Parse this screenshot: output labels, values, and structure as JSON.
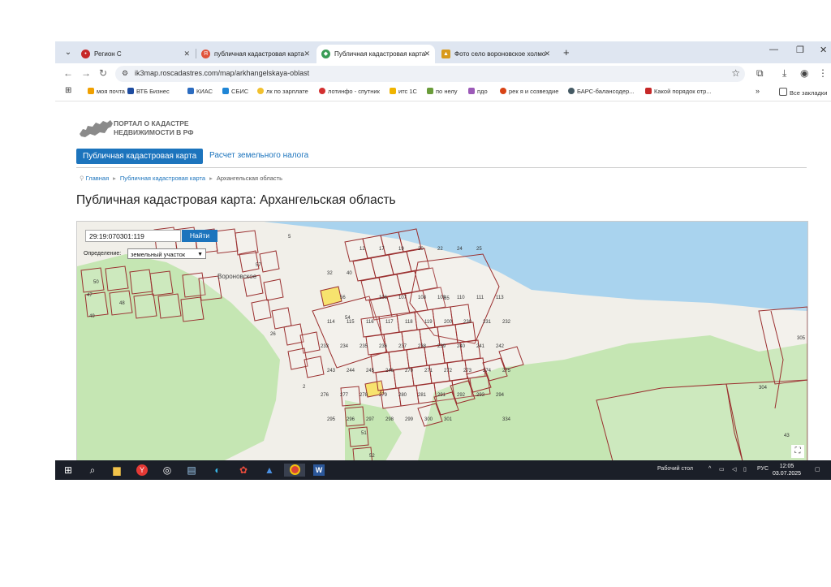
{
  "browser": {
    "tabs": [
      {
        "title": "Регион С",
        "active": false
      },
      {
        "title": "публичная кадастровая карта",
        "active": false
      },
      {
        "title": "Публичная кадастровая карта",
        "active": true
      },
      {
        "title": "Фото село вороновское холмо",
        "active": false
      }
    ],
    "url": "ik3map.roscadastres.com/map/arkhangelskaya-oblast",
    "bookmarks": [
      "моя почта",
      "ВТБ Бизнес",
      "КИАС",
      "СБИС",
      "лк по зарплате",
      "лотинфо - спутник",
      "итс 1С",
      "по нелу",
      "пдо",
      "рек я и созвездие",
      "БАРС-балансодер...",
      "Какой порядок отр..."
    ],
    "all_bookmarks": "Все закладки"
  },
  "site": {
    "logo_text": "ПОРТАЛ О КАДАСТРЕ НЕДВИЖИМОСТИ В РФ",
    "nav": {
      "active": "Публичная кадастровая карта",
      "other": "Расчет земельного налога"
    },
    "breadcrumbs": [
      "Главная",
      "Публичная кадастровая карта",
      "Архангельская область"
    ],
    "title": "Публичная кадастровая карта: Архангельская область"
  },
  "map": {
    "search_value": "29:19:070301:119",
    "search_button": "Найти",
    "definition_label": "Определение:",
    "definition_value": "земельный участок",
    "village_label": "Вороновское",
    "colors": {
      "land": "#f1efe9",
      "water": "#a9d3ee",
      "forest": "#c5e6b3",
      "parcel_border": "#9a2f2f",
      "highlight": "#f7e36e"
    },
    "parcel_labels": [
      "2",
      "5",
      "12",
      "17",
      "19",
      "20",
      "22",
      "24",
      "25",
      "26",
      "32",
      "40",
      "43",
      "47",
      "48",
      "49",
      "50",
      "51",
      "52",
      "54",
      "55",
      "56",
      "57",
      "106",
      "107",
      "108",
      "109",
      "110",
      "111",
      "113",
      "114",
      "115",
      "116",
      "117",
      "118",
      "119",
      "200",
      "230",
      "231",
      "232",
      "233",
      "234",
      "235",
      "236",
      "237",
      "238",
      "239",
      "240",
      "241",
      "242",
      "243",
      "244",
      "245",
      "246",
      "270",
      "271",
      "272",
      "273",
      "274",
      "275",
      "276",
      "277",
      "278",
      "279",
      "280",
      "281",
      "291",
      "292",
      "293",
      "294",
      "295",
      "296",
      "297",
      "298",
      "299",
      "300",
      "301",
      "304",
      "305",
      "334"
    ]
  },
  "taskbar": {
    "desktop_label": "Рабочий стол",
    "lang": "РУС",
    "time": "12:05",
    "date": "03.07.2025"
  }
}
